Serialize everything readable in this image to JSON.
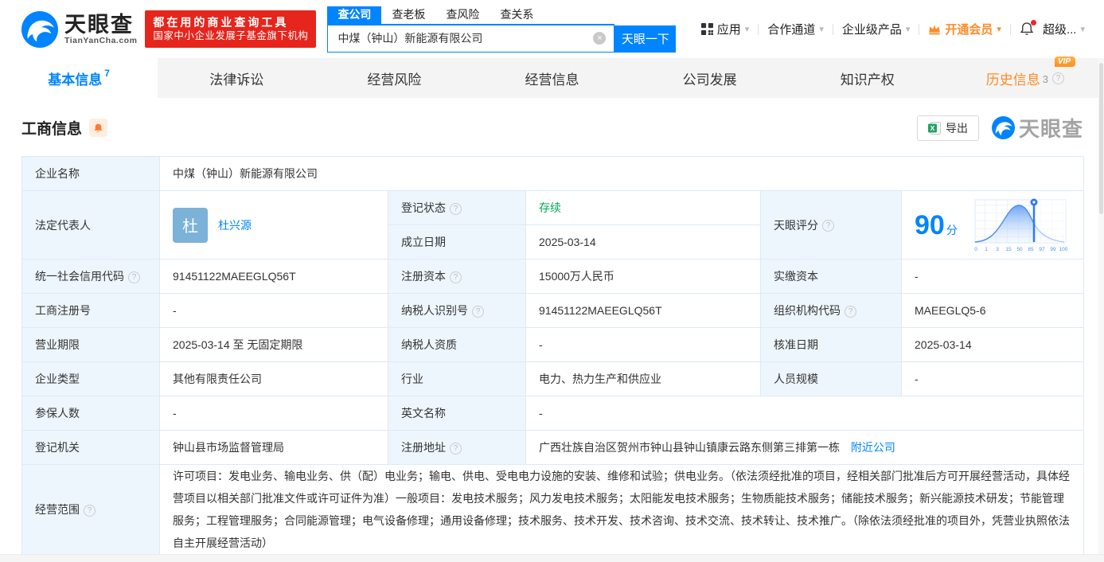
{
  "brand": {
    "name": "天眼查",
    "domain": "TianYanCha.com",
    "accent_color": "#0084ff"
  },
  "promo": {
    "line1": "都在用的商业查询工具",
    "line2": "国家中小企业发展子基金旗下机构",
    "bg_color": "#e6251c"
  },
  "search": {
    "tabs": {
      "company": "查公司",
      "boss": "查老板",
      "risk": "查风险",
      "relation": "查关系"
    },
    "value": "中煤（钟山）新能源有限公司",
    "button_label": "天眼一下"
  },
  "nav": {
    "apps": "应用",
    "partner": "合作通道",
    "enterprise": "企业级产品",
    "vip": "开通会员",
    "super": "超级..."
  },
  "tabs": {
    "basic": {
      "label": "基本信息",
      "count": "7"
    },
    "legal": {
      "label": "法律诉讼"
    },
    "risk": {
      "label": "经营风险"
    },
    "operation": {
      "label": "经营信息"
    },
    "development": {
      "label": "公司发展"
    },
    "ip": {
      "label": "知识产权"
    },
    "history": {
      "label": "历史信息",
      "count": "3",
      "vip_tag": "VIP"
    }
  },
  "section": {
    "title": "工商信息",
    "export_label": "导出",
    "watermark": "天眼查"
  },
  "info": {
    "row1": {
      "label": "企业名称",
      "value": "中煤（钟山）新能源有限公司"
    },
    "row2": {
      "label": "法定代表人",
      "avatar": "杜",
      "name": "杜兴源",
      "sub1_label": "登记状态",
      "sub1_value": "存续",
      "sub2_label": "成立日期",
      "sub2_value": "2025-03-14",
      "score_label": "天眼评分",
      "score": "90",
      "score_unit": "分"
    },
    "row3": {
      "l1": "统一社会信用代码",
      "v1": "91451122MAEEGLQ56T",
      "l2": "注册资本",
      "v2": "15000万人民币",
      "l3": "实缴资本",
      "v3": "-"
    },
    "row4": {
      "l1": "工商注册号",
      "v1": "-",
      "l2": "纳税人识别号",
      "v2": "91451122MAEEGLQ56T",
      "l3": "组织机构代码",
      "v3": "MAEEGLQ5-6"
    },
    "row5": {
      "l1": "营业期限",
      "v1": "2025-03-14 至 无固定期限",
      "l2": "纳税人资质",
      "v2": "-",
      "l3": "核准日期",
      "v3": "2025-03-14"
    },
    "row6": {
      "l1": "企业类型",
      "v1": "其他有限责任公司",
      "l2": "行业",
      "v2": "电力、热力生产和供应业",
      "l3": "人员规模",
      "v3": "-"
    },
    "row7": {
      "l1": "参保人数",
      "v1": "-",
      "l2": "英文名称",
      "v2": "-"
    },
    "row8": {
      "l1": "登记机关",
      "v1": "钟山县市场监督管理局",
      "l2": "注册地址",
      "v2": "广西壮族自治区贺州市钟山县钟山镇康云路东侧第三排第一栋",
      "nearby_link": "附近公司"
    },
    "row9": {
      "label": "经营范围",
      "value": "许可项目：发电业务、输电业务、供（配）电业务；输电、供电、受电电力设施的安装、维修和试验；供电业务。（依法须经批准的项目，经相关部门批准后方可开展经营活动，具体经营项目以相关部门批准文件或许可证件为准）一般项目：发电技术服务；风力发电技术服务；太阳能发电技术服务；生物质能技术服务；储能技术服务；新兴能源技术研发；节能管理服务；工程管理服务；合同能源管理；电气设备修理；通用设备修理；技术服务、技术开发、技术咨询、技术交流、技术转让、技术推广。（除依法须经批准的项目外，凭营业执照依法自主开展经营活动）"
    }
  },
  "chart_data": {
    "type": "area",
    "title": "天眼评分分布曲线",
    "x_tick_labels": [
      "0",
      "1",
      "3",
      "15",
      "50",
      "85",
      "97",
      "99",
      "100"
    ],
    "marker_value": 90,
    "score": 90,
    "curve": "bell",
    "accent": "#4a90f5"
  },
  "icons": {
    "caret": "▾",
    "help": "?",
    "clear": "×"
  }
}
